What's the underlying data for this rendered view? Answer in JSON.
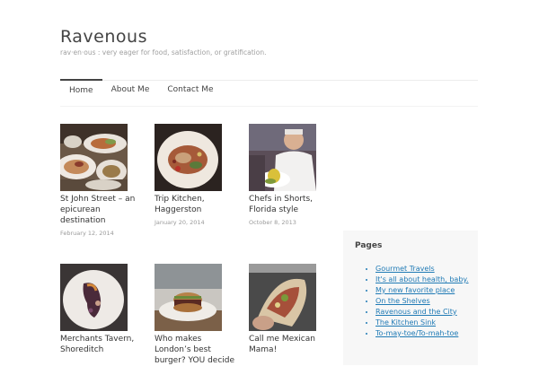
{
  "site": {
    "title": "Ravenous",
    "description": "rav·en·ous : very eager for food, satisfaction, or gratification."
  },
  "nav": {
    "items": [
      "Home",
      "About Me",
      "Contact Me"
    ],
    "active": "Home"
  },
  "posts": [
    {
      "title": "St John Street – an epicurean destination",
      "date": "February 12, 2014"
    },
    {
      "title": "Trip Kitchen, Haggerston",
      "date": "January 20, 2014"
    },
    {
      "title": "Chefs in Shorts, Florida style",
      "date": "October 8, 2013"
    },
    {
      "title": "Merchants Tavern, Shoreditch",
      "date": ""
    },
    {
      "title": "Who makes London’s best burger? YOU decide",
      "date": ""
    },
    {
      "title": "Call me Mexican Mama!",
      "date": ""
    }
  ],
  "sidebar": {
    "widget_title": "Pages",
    "pages": [
      "Gourmet Travels",
      "It's all about health, baby.",
      "My new favorite place",
      "On the Shelves",
      "Ravenous and the City",
      "The Kitchen Sink",
      "To-may-toe/To-mah-toe"
    ]
  },
  "colors": {
    "link": "#1f7ab5",
    "sidebar_bg": "#f7f7f7",
    "title": "#444444"
  }
}
